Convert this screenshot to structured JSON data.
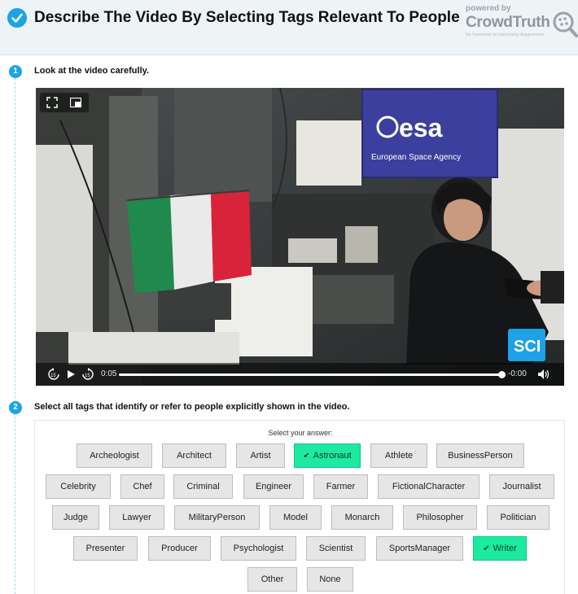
{
  "header": {
    "title": "Describe The Video By Selecting Tags Relevant To People",
    "brand_powered": "powered by",
    "brand_name": "CrowdTruth",
    "brand_tagline": "the framework for harnessing disagreement"
  },
  "steps": [
    {
      "number": "1",
      "text": "Look at the video carefully."
    },
    {
      "number": "2",
      "text": "Select all tags that identify or refer to people explicitly shown in the video."
    }
  ],
  "video": {
    "flag_caption": "esa",
    "banner_text": "European Space Agency",
    "channel_badge": "SCI",
    "current_time": "0:05",
    "remaining_time": "-0:00",
    "progress": 1.0,
    "colors": {
      "flag_green": "#1f8a4c",
      "flag_white": "#eaeaea",
      "flag_red": "#d8233a",
      "banner": "#3c3f9e"
    }
  },
  "answers": {
    "label": "Select your answer:",
    "rows": [
      [
        {
          "label": "Archeologist",
          "selected": false
        },
        {
          "label": "Architect",
          "selected": false
        },
        {
          "label": "Artist",
          "selected": false
        },
        {
          "label": "Astronaut",
          "selected": true
        },
        {
          "label": "Athlete",
          "selected": false
        },
        {
          "label": "BusinessPerson",
          "selected": false
        }
      ],
      [
        {
          "label": "Celebrity",
          "selected": false
        },
        {
          "label": "Chef",
          "selected": false
        },
        {
          "label": "Criminal",
          "selected": false
        },
        {
          "label": "Engineer",
          "selected": false
        },
        {
          "label": "Farmer",
          "selected": false
        },
        {
          "label": "FictionalCharacter",
          "selected": false
        },
        {
          "label": "Journalist",
          "selected": false
        }
      ],
      [
        {
          "label": "Judge",
          "selected": false
        },
        {
          "label": "Lawyer",
          "selected": false
        },
        {
          "label": "MilitaryPerson",
          "selected": false
        },
        {
          "label": "Model",
          "selected": false
        },
        {
          "label": "Monarch",
          "selected": false
        },
        {
          "label": "Philosopher",
          "selected": false
        },
        {
          "label": "Politician",
          "selected": false
        }
      ],
      [
        {
          "label": "Presenter",
          "selected": false
        },
        {
          "label": "Producer",
          "selected": false
        },
        {
          "label": "Psychologist",
          "selected": false
        },
        {
          "label": "Scientist",
          "selected": false
        },
        {
          "label": "SportsManager",
          "selected": false
        },
        {
          "label": "Writer",
          "selected": true
        }
      ],
      [
        {
          "label": "Other",
          "selected": false
        },
        {
          "label": "None",
          "selected": false
        }
      ]
    ]
  },
  "colors": {
    "accent": "#1aa3e8",
    "selected": "#1de9a0",
    "header_bg": "#eef3f6"
  }
}
